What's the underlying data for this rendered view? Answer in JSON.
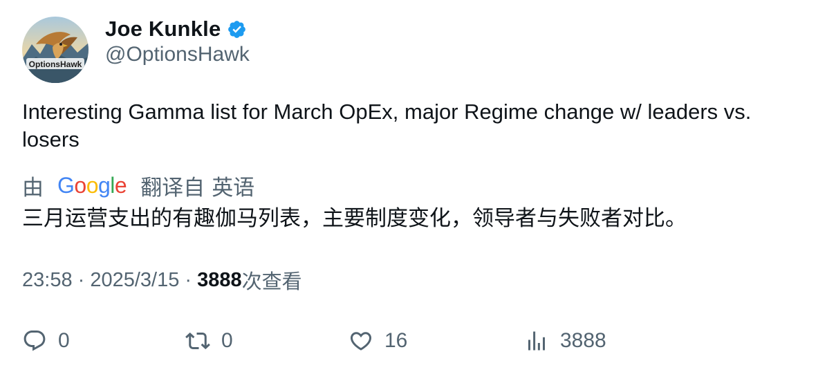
{
  "author": {
    "display_name": "Joe Kunkle",
    "handle": "@OptionsHawk",
    "avatar_text": "OptionsHawk",
    "verified_icon": "verified-badge-icon",
    "verified_color": "#1d9bf0"
  },
  "tweet": {
    "text": "Interesting Gamma list for March OpEx, major Regime change w/ leaders vs. losers",
    "translate_prefix": "由",
    "translate_provider": "Google",
    "translate_from": "翻译自",
    "translate_lang": "英语",
    "translation": "三月运营支出的有趣伽马列表，主要制度变化，领导者与失败者对比。"
  },
  "meta": {
    "time": "23:58",
    "separator": " · ",
    "date": "2025/3/15",
    "views_count": "3888",
    "views_label": "次查看"
  },
  "actions": {
    "reply": {
      "icon": "reply-icon",
      "count": "0"
    },
    "retweet": {
      "icon": "retweet-icon",
      "count": "0"
    },
    "like": {
      "icon": "heart-icon",
      "count": "16"
    },
    "views": {
      "icon": "views-chart-icon",
      "count": "3888"
    }
  },
  "colors": {
    "text_primary": "#0f1419",
    "text_secondary": "#536471",
    "google_blue": "#4285f4",
    "google_red": "#ea4335",
    "google_yellow": "#fbbc05",
    "google_green": "#34a853"
  }
}
